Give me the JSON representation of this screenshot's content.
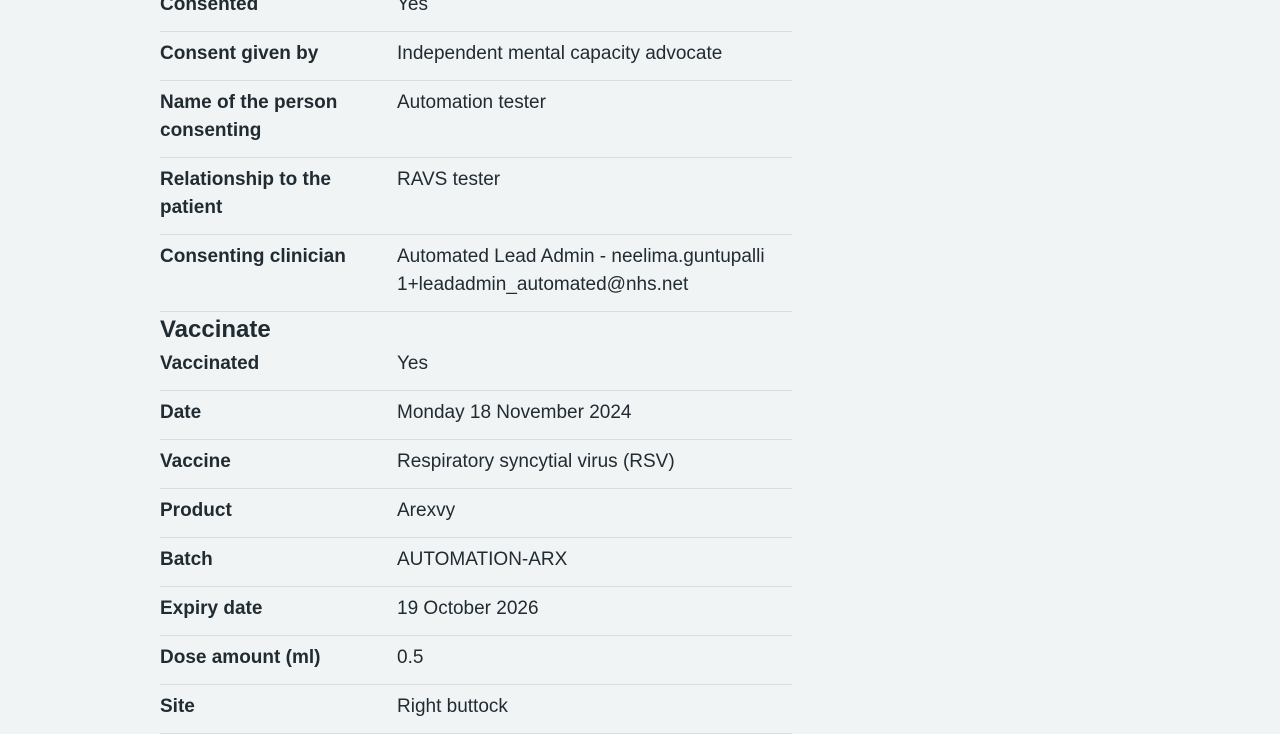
{
  "consent_rows": [
    {
      "key": "Consented",
      "value": "Yes"
    },
    {
      "key": "Consent given by",
      "value": "Independent mental capacity advocate"
    },
    {
      "key": "Name of the person consenting",
      "value": "Automation tester"
    },
    {
      "key": "Relationship to the patient",
      "value": "RAVS tester"
    },
    {
      "key": "Consenting clinician",
      "value": "Automated Lead Admin - neelima.guntupalli1+leadadmin_automated@nhs.net"
    }
  ],
  "vaccinate_section": {
    "heading": "Vaccinate",
    "rows": [
      {
        "key": "Vaccinated",
        "value": "Yes"
      },
      {
        "key": "Date",
        "value": "Monday 18 November 2024"
      },
      {
        "key": "Vaccine",
        "value": "Respiratory syncytial virus (RSV)"
      },
      {
        "key": "Product",
        "value": "Arexvy"
      },
      {
        "key": "Batch",
        "value": "AUTOMATION-ARX"
      },
      {
        "key": "Expiry date",
        "value": "19 October 2026"
      },
      {
        "key": "Dose amount (ml)",
        "value": "0.5"
      },
      {
        "key": "Site",
        "value": "Right buttock"
      }
    ]
  }
}
